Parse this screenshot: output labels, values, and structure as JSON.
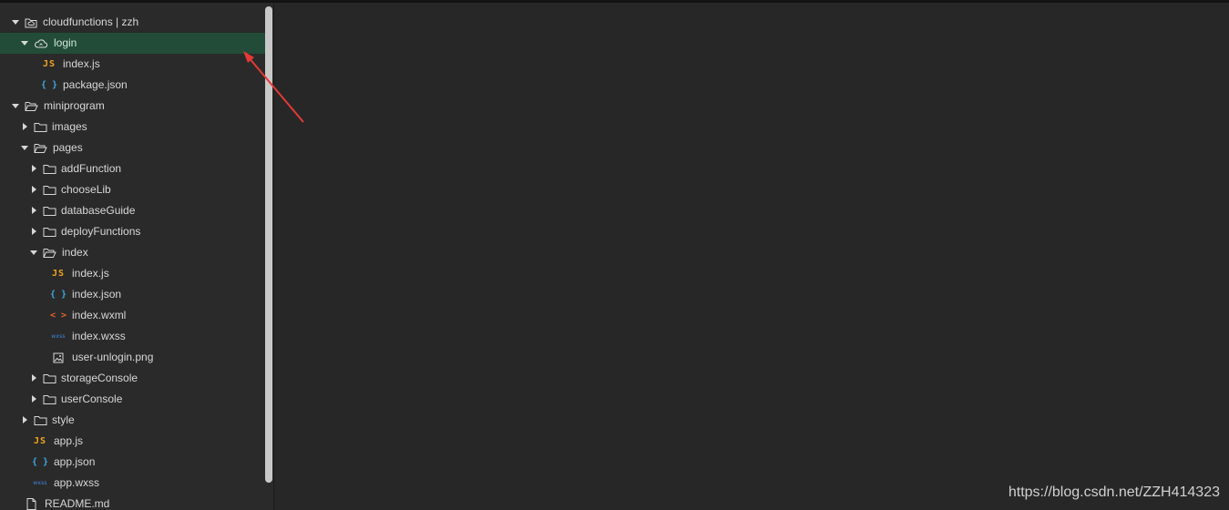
{
  "explorer": {
    "items": [
      {
        "label": "cloudfunctions | zzh",
        "arrow": "down",
        "icon": "cloud-folder-icon"
      },
      {
        "label": "login",
        "arrow": "down",
        "icon": "cloud-icon",
        "selected": true
      },
      {
        "label": "index.js",
        "icon": "js-file-icon"
      },
      {
        "label": "package.json",
        "icon": "json-file-icon"
      },
      {
        "label": "miniprogram",
        "arrow": "down",
        "icon": "folder-open-icon"
      },
      {
        "label": "images",
        "arrow": "right",
        "icon": "folder-icon"
      },
      {
        "label": "pages",
        "arrow": "down",
        "icon": "folder-open-icon"
      },
      {
        "label": "addFunction",
        "arrow": "right",
        "icon": "folder-icon"
      },
      {
        "label": "chooseLib",
        "arrow": "right",
        "icon": "folder-icon"
      },
      {
        "label": "databaseGuide",
        "arrow": "right",
        "icon": "folder-icon"
      },
      {
        "label": "deployFunctions",
        "arrow": "right",
        "icon": "folder-icon"
      },
      {
        "label": "index",
        "arrow": "down",
        "icon": "folder-open-icon"
      },
      {
        "label": "index.js",
        "icon": "js-file-icon"
      },
      {
        "label": "index.json",
        "icon": "json-file-icon"
      },
      {
        "label": "index.wxml",
        "icon": "wxml-file-icon"
      },
      {
        "label": "index.wxss",
        "icon": "wxss-file-icon"
      },
      {
        "label": "user-unlogin.png",
        "icon": "image-file-icon"
      },
      {
        "label": "storageConsole",
        "arrow": "right",
        "icon": "folder-icon"
      },
      {
        "label": "userConsole",
        "arrow": "right",
        "icon": "folder-icon"
      },
      {
        "label": "style",
        "arrow": "right",
        "icon": "folder-icon"
      },
      {
        "label": "app.js",
        "icon": "js-file-icon"
      },
      {
        "label": "app.json",
        "icon": "json-file-icon"
      },
      {
        "label": "app.wxss",
        "icon": "wxss-file-icon"
      },
      {
        "label": "README.md",
        "icon": "file-icon"
      }
    ],
    "icon_text": {
      "js": "JS",
      "json": "{ }",
      "wxml": "< >",
      "wxss": "wxss"
    }
  },
  "watermark": "https://blog.csdn.net/ZZH414323",
  "colors": {
    "selected_row": "#224c37",
    "annotation_arrow": "#e53935"
  }
}
